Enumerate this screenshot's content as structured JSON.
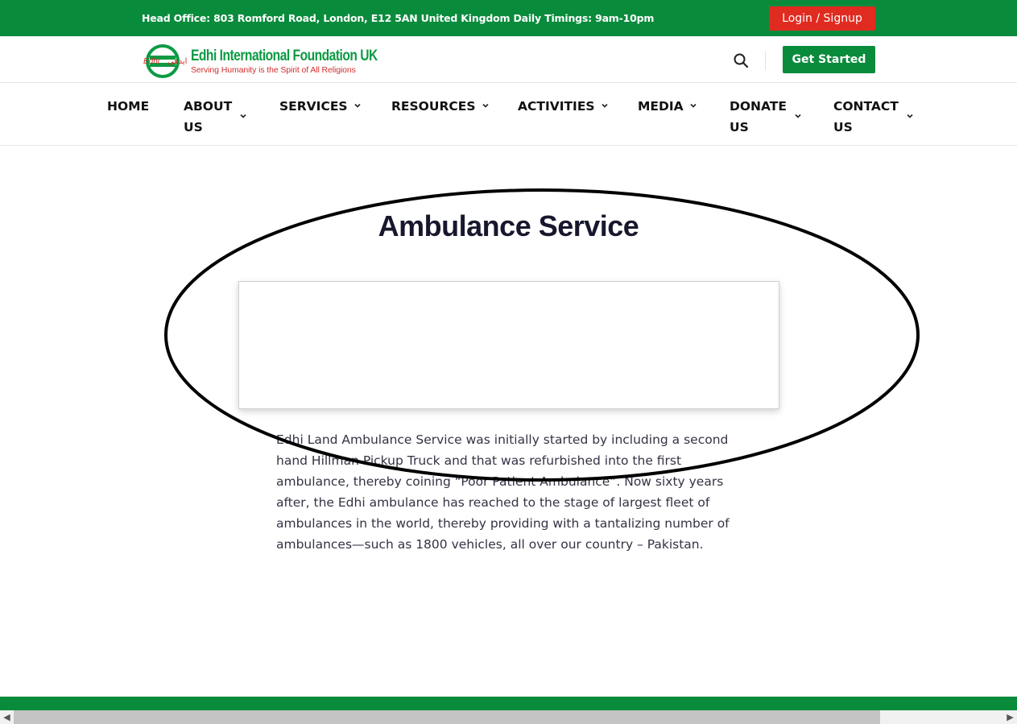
{
  "topbar": {
    "info": "Head Office: 803 Romford Road, London, E12 5AN United Kingdom Daily Timings: 9am-10pm",
    "login_label": "Login / Signup"
  },
  "header": {
    "logo_title": "Edhi International Foundation UK",
    "logo_tagline": "Serving Humanity is the Spirit of All Religions",
    "search_icon": "search-icon",
    "get_started_label": "Get Started"
  },
  "nav": {
    "items": [
      {
        "label": "HOME",
        "has_dropdown": false
      },
      {
        "label": "ABOUT",
        "label2": "US",
        "has_dropdown": true
      },
      {
        "label": "SERVICES",
        "has_dropdown": true
      },
      {
        "label": "RESOURCES",
        "has_dropdown": true
      },
      {
        "label": "ACTIVITIES",
        "has_dropdown": true
      },
      {
        "label": "MEDIA",
        "has_dropdown": true
      },
      {
        "label": "DONATE",
        "label2": "US",
        "has_dropdown": true
      },
      {
        "label": "CONTACT",
        "label2": "US",
        "has_dropdown": true
      }
    ]
  },
  "main": {
    "title": "Ambulance Service",
    "body": "Edhi Land Ambulance Service was initially started by including a second hand Hillman Pickup Truck and that was refurbished into the first ambulance, thereby coining “Poor Patient Ambulance”. Now sixty years after, the Edhi ambulance has reached to the stage of largest fleet of ambulances in the world, thereby providing with a tantalizing number of ambulances—such as 1800 vehicles, all over our country – Pakistan."
  },
  "colors": {
    "brand_green": "#098b3c",
    "login_red": "#e02b20",
    "title_navy": "#17172e"
  }
}
